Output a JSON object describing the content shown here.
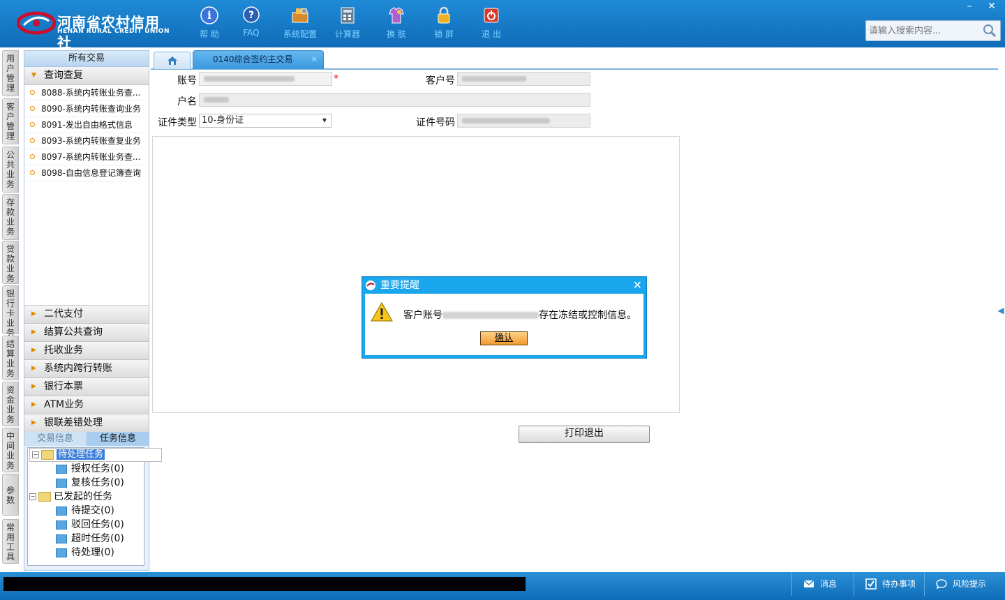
{
  "header": {
    "logo_cn": "河南省农村信用社",
    "logo_en": "HENAN RURAL CREDIT UNION",
    "tools": [
      {
        "label": "帮 助",
        "icon": "help-icon"
      },
      {
        "label": "FAQ",
        "icon": "faq-icon"
      },
      {
        "label": "系统配置",
        "icon": "config-icon"
      },
      {
        "label": "计算器",
        "icon": "calculator-icon"
      },
      {
        "label": "换 肤",
        "icon": "skin-icon"
      },
      {
        "label": "锁 屏",
        "icon": "lock-icon"
      },
      {
        "label": "退 出",
        "icon": "exit-icon"
      }
    ],
    "minimize": "–",
    "close": "✕",
    "search_placeholder": "请输入搜索内容..."
  },
  "vtabs": [
    "用户管理",
    "客户管理",
    "公共业务",
    "存款业务",
    "贷款业务",
    "银行卡业务",
    "结算业务",
    "资金业务",
    "中间业务",
    "参数",
    "常用工具"
  ],
  "left": {
    "title": "所有交易",
    "open_category": "查询查复",
    "items": [
      "8088-系统内转账业务查...",
      "8090-系统内转账查询业务",
      "8091-发出自由格式信息",
      "8093-系统内转账查复业务",
      "8097-系统内转账业务查...",
      "8098-自由信息登记簿查询"
    ],
    "categories": [
      "二代支付",
      "结算公共查询",
      "托收业务",
      "系统内跨行转账",
      "银行本票",
      "ATM业务",
      "银联差错处理"
    ],
    "bottom_tabs": [
      "交易信息",
      "任务信息"
    ],
    "tree": [
      {
        "label": "待处理任务",
        "level": 0,
        "selected": true
      },
      {
        "label": "授权任务(0)",
        "level": 1
      },
      {
        "label": "复核任务(0)",
        "level": 1
      },
      {
        "label": "已发起的任务",
        "level": 0
      },
      {
        "label": "待提交(0)",
        "level": 1
      },
      {
        "label": "驳回任务(0)",
        "level": 1
      },
      {
        "label": "超时任务(0)",
        "level": 1
      },
      {
        "label": "待处理(0)",
        "level": 1
      }
    ]
  },
  "main": {
    "tab_label": "0140综合签约主交易",
    "tab_close": "×",
    "form": {
      "account_label": "账号",
      "required_mark": "*",
      "customer_no_label": "客户号",
      "name_label": "户名",
      "id_type_label": "证件类型",
      "id_type_value": "10-身份证",
      "id_no_label": "证件号码"
    },
    "print_exit": "打印退出"
  },
  "dialog": {
    "title": "重要提醒",
    "close": "✕",
    "msg_prefix": "客户账号",
    "msg_suffix": "存在冻结或控制信息。",
    "ok": "确认"
  },
  "status": {
    "message": "消息",
    "todo": "待办事项",
    "risk": "风险提示"
  },
  "colors": {
    "header_blue": "#1477c4",
    "dialog_blue": "#1aa6ec",
    "ok_orange": "#f29a2e"
  }
}
